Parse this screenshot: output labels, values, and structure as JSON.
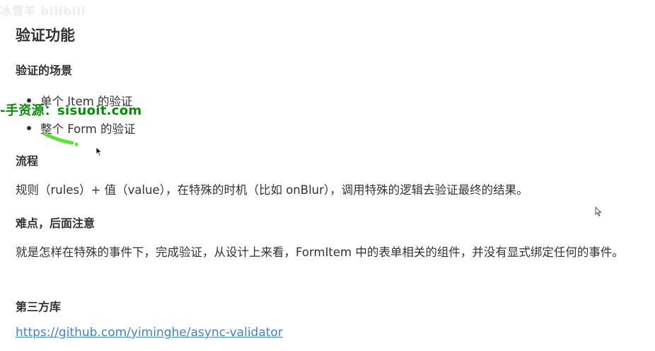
{
  "watermark_top": "冰雪羊 bilibili",
  "heading": "验证功能",
  "sections": {
    "scenes_title": "验证的场景",
    "scenes_items": [
      "单个 Item 的验证",
      "整个 Form 的验证"
    ],
    "flow_title": "流程",
    "flow_text": "规则（rules）+ 值（value），在特殊的时机（比如 onBlur），调用特殊的逻辑去验证最终的结果。",
    "difficulty_title": "难点，后面注意",
    "difficulty_text": "就是怎样在特殊的事件下，完成验证，从设计上来看，FormItem 中的表单相关的组件，并没有显式绑定任何的事件。",
    "library_title": "第三方库",
    "library_link": "https://github.com/yiminghe/async-validator"
  },
  "overlay_watermark": "-手资源：sisuoit.com",
  "colors": {
    "text": "#333333",
    "link": "#4183c4",
    "watermark_green": "#0a8a0a",
    "highlight_green": "#66dd44"
  },
  "icons": [
    "mouse-cursor-icon"
  ]
}
